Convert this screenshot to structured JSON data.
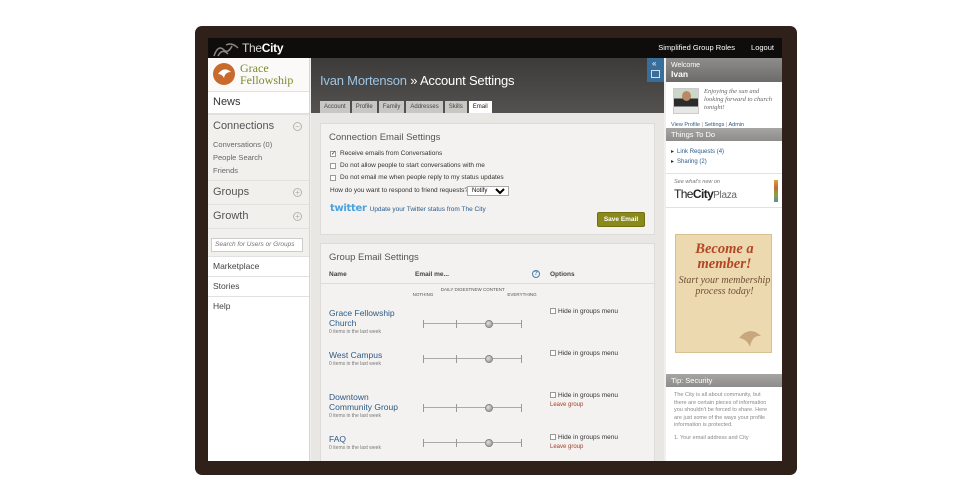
{
  "topbar": {
    "logo_text_light": "The",
    "logo_text_bold": "City",
    "links": [
      "Simplified Group Roles",
      "Logout"
    ]
  },
  "sidebar": {
    "church_name_line1": "Grace",
    "church_name_line2": "Fellowship",
    "news": "News",
    "connections": "Connections",
    "connection_items": [
      "Conversations (0)",
      "People Search",
      "Friends"
    ],
    "groups": "Groups",
    "growth": "Growth",
    "search_placeholder": "Search for Users or Groups",
    "links": [
      "Marketplace",
      "Stories",
      "Help"
    ]
  },
  "header": {
    "person": "Ivan Mortenson",
    "separator": " » ",
    "title": "Account Settings",
    "collapse_glyph": "«",
    "tabs": [
      "Account",
      "Profile",
      "Family",
      "Addresses",
      "Skills",
      "Email"
    ],
    "active_tab": "Email"
  },
  "connection_email": {
    "heading": "Connection Email Settings",
    "options": [
      {
        "label": "Receive emails from Conversations",
        "checked": true
      },
      {
        "label": "Do not allow people to start conversations with me",
        "checked": false
      },
      {
        "label": "Do not email me when people reply to my status updates",
        "checked": false
      }
    ],
    "respond_label": "How do you want to respond to friend requests?",
    "respond_value": "Notify",
    "twitter_logo": "twitter",
    "twitter_text": "Update your Twitter status from The City",
    "save_label": "Save Email"
  },
  "group_email": {
    "heading": "Group Email Settings",
    "col_name": "Name",
    "col_email": "Email me...",
    "col_options": "Options",
    "help_glyph": "?",
    "levels": [
      "NOTHING",
      "DAILY DIGEST",
      "NEW CONTENT",
      "EVERYTHING"
    ],
    "hide_label": "Hide in groups menu",
    "leave_label": "Leave group",
    "groups": [
      {
        "name": "Grace Fellowship Church",
        "count": "0 items in the last week",
        "level": "NEW CONTENT",
        "leave": false
      },
      {
        "name": "West Campus",
        "count": "0 items in the last week",
        "level": "NEW CONTENT",
        "leave": false
      },
      {
        "name": "Downtown Community Group",
        "count": "0 items in the last week",
        "level": "NEW CONTENT",
        "leave": true
      },
      {
        "name": "FAQ",
        "count": "0 items in the last week",
        "level": "NEW CONTENT",
        "leave": true
      }
    ]
  },
  "right": {
    "welcome": "Welcome",
    "user": "Ivan",
    "status": "Enjoying the sun and looking forward to church tonight!",
    "profile_links": [
      "View Profile",
      "Settings",
      "Admin"
    ],
    "todo_heading": "Things To Do",
    "todo_items": [
      "Link Requests (4)",
      "Sharing (2)"
    ],
    "plaza_line1": "See what's new on",
    "plaza_the": "The",
    "plaza_city": "City",
    "plaza_plaza": "Plaza",
    "member_title": "Become a member!",
    "member_body": "Start your membership process today!",
    "tip_heading": "Tip: Security",
    "tip_body": "The City is all about community, but there are certain pieces of information you shouldn't be forced to share. Here are just some of the ways your profile information is protected.",
    "tip_more": "1. Your email address and City"
  },
  "colors": {
    "frame": "#2f2119",
    "accent_olive": "#8a8a1c",
    "link_blue": "#2c5a86",
    "header_name": "#9dc5e4",
    "leave_red": "#a23f2a",
    "member_red": "#b34725"
  }
}
